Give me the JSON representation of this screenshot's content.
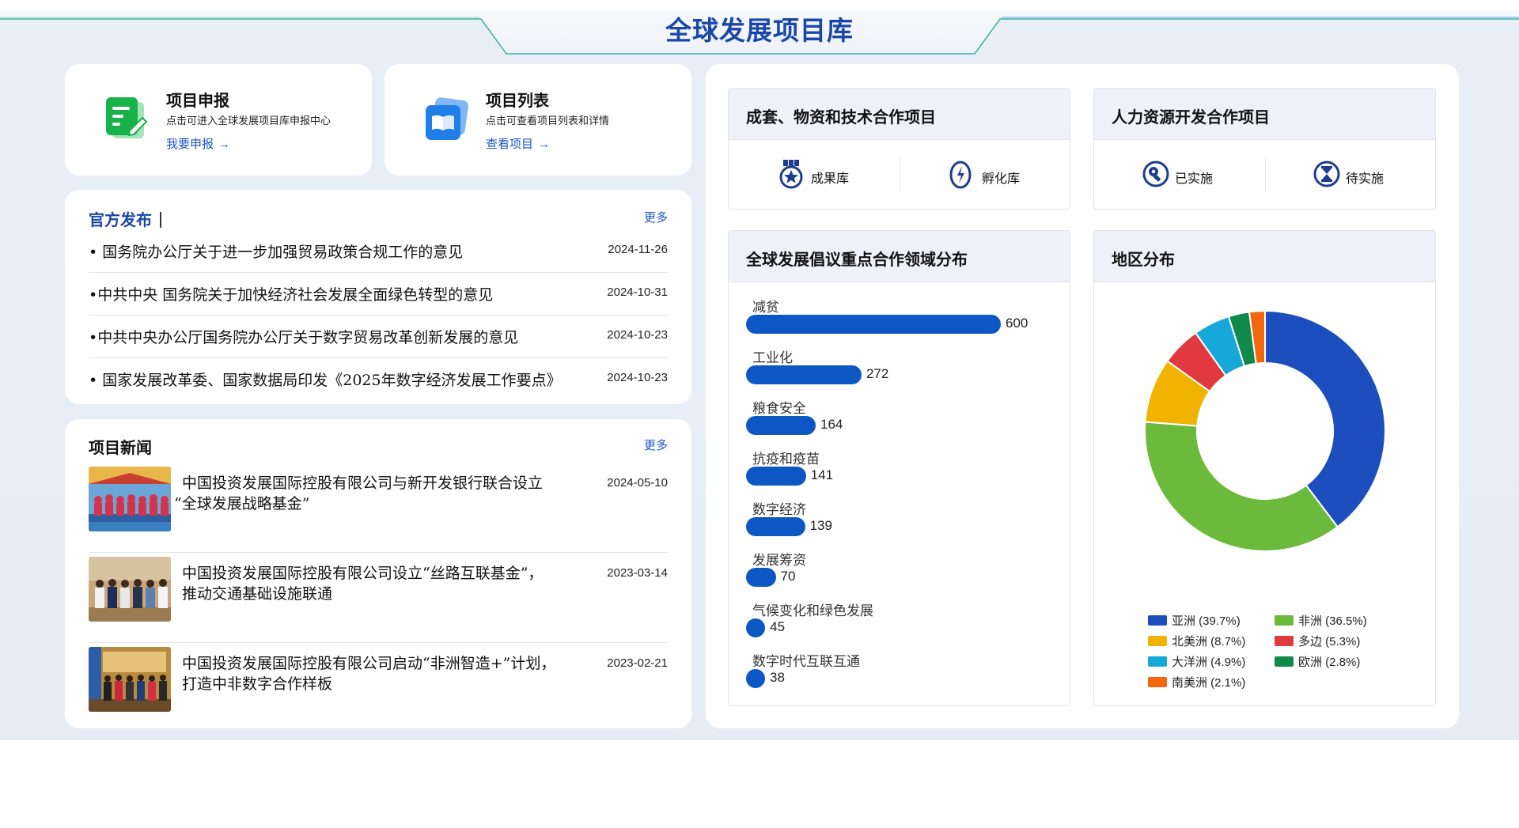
{
  "header": {
    "title": "全球发展项目库"
  },
  "quick_cards": [
    {
      "title": "项目申报",
      "desc": "点击可进入全球发展项目库申报中心",
      "link": "我要申报",
      "icon": "document-edit-icon",
      "color": "#1cb34a"
    },
    {
      "title": "项目列表",
      "desc": "点击可查看项目列表和详情",
      "link": "查看项目",
      "icon": "book-icon",
      "color": "#1f7ee8"
    }
  ],
  "official": {
    "title": "官方发布",
    "more": "更多",
    "items": [
      {
        "text": "• 国务院办公厅关于进一步加强贸易政策合规工作的意见",
        "date": "2024-11-26"
      },
      {
        "text": "•中共中央 国务院关于加快经济社会发展全面绿色转型的意见",
        "date": "2024-10-31"
      },
      {
        "text": "•中共中央办公厅国务院办公厅关于数字贸易改革创新发展的意见",
        "date": "2024-10-23"
      },
      {
        "text": "• 国家发展改革委、国家数据局印发《2025年数字经济发展工作要点》",
        "date": "2024-10-23"
      }
    ]
  },
  "news": {
    "title": "项目新闻",
    "more": "更多",
    "items": [
      {
        "line1": "中国投资发展国际控股有限公司与新开发银行联合设立",
        "line2": "“全球发展战略基金”",
        "date": "2024-05-10"
      },
      {
        "line1": "中国投资发展国际控股有限公司设立“丝路互联基金”，",
        "line2": "推动交通基础设施联通",
        "date": "2023-03-14"
      },
      {
        "line1": "中国投资发展国际控股有限公司启动“非洲智造+”计划，",
        "line2": "打造中非数字合作样板",
        "date": "2023-02-21"
      }
    ]
  },
  "panel_cooperation": {
    "title": "成套、物资和技术合作项目",
    "buttons": [
      {
        "label": "成果库",
        "icon": "medal-icon"
      },
      {
        "label": "孵化库",
        "icon": "incubator-icon"
      }
    ]
  },
  "panel_hr": {
    "title": "人力资源开发合作项目",
    "buttons": [
      {
        "label": "已实施",
        "icon": "wrench-icon"
      },
      {
        "label": "待实施",
        "icon": "hourglass-icon"
      }
    ]
  },
  "panel_bar": {
    "title": "全球发展倡议重点合作领域分布"
  },
  "panel_pie": {
    "title": "地区分布"
  },
  "chart_data": [
    {
      "type": "bar",
      "orientation": "horizontal",
      "categories": [
        "减贫",
        "工业化",
        "粮食安全",
        "抗疫和疫苗",
        "数字经济",
        "发展筹资",
        "气候变化和绿色发展",
        "数字时代互联互通"
      ],
      "values": [
        600,
        272,
        164,
        141,
        139,
        70,
        45,
        38
      ],
      "color": "#0d57c4",
      "xlim": [
        0,
        600
      ]
    },
    {
      "type": "pie",
      "style": "donut",
      "labels": [
        "亚洲 (39.7%)",
        "非洲 (36.5%)",
        "北美洲 (8.7%)",
        "多边 (5.3%)",
        "大洋洲 (4.9%)",
        "欧洲 (2.8%)",
        "南美洲 (2.1%)"
      ],
      "values": [
        39.7,
        36.5,
        8.7,
        5.3,
        4.9,
        2.8,
        2.1
      ],
      "colors": [
        "#1c4fbd",
        "#6cba3b",
        "#f0b400",
        "#e0393e",
        "#16a8d8",
        "#0f8a4a",
        "#f2660d"
      ],
      "legend": "bottom"
    }
  ]
}
